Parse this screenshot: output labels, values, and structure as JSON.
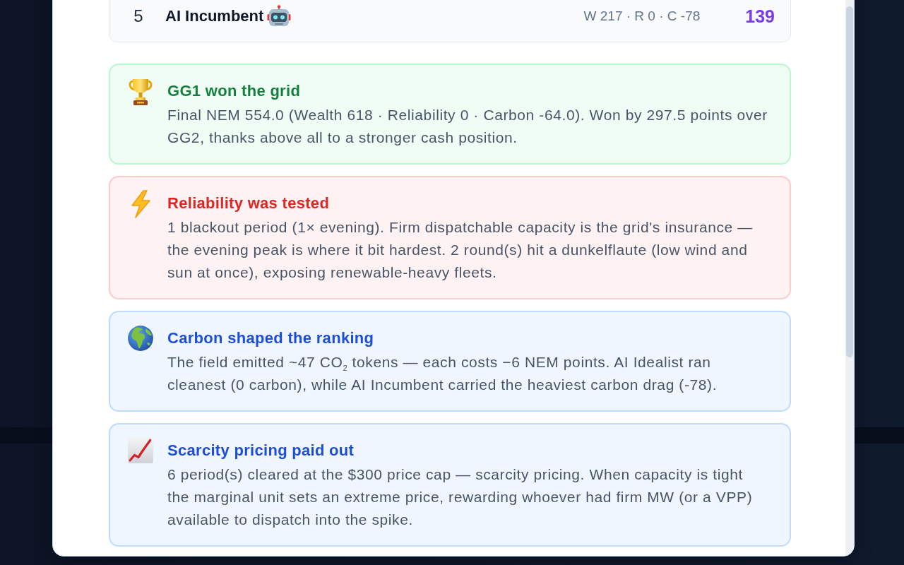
{
  "leaderboard_row": {
    "rank": "5",
    "name": "AI Incumbent",
    "stats": "W 217 · R 0 · C -78",
    "score": "139"
  },
  "insights": [
    {
      "kind": "winner",
      "title": "GG1 won the grid",
      "text": "Final NEM 554.0 (Wealth 618 · Reliability 0 · Carbon -64.0). Won by 297.5 points over GG2, thanks above all to a stronger cash position."
    },
    {
      "kind": "reliability",
      "title": "Reliability was tested",
      "text": "1 blackout period (1× evening). Firm dispatchable capacity is the grid's insurance — the evening peak is where it bit hardest. 2 round(s) hit a dunkelflaute (low wind and sun at once), exposing renewable-heavy fleets."
    },
    {
      "kind": "carbon",
      "title": "Carbon shaped the ranking",
      "text": "The field emitted ~47 CO$_{2}$ tokens — each costs −6 NEM points. AI Idealist ran cleanest (0 carbon), while AI Incumbent carried the heaviest carbon drag (-78)."
    },
    {
      "kind": "pricing",
      "title": "Scarcity pricing paid out",
      "text": "6 period(s) cleared at the $300 price cap — scarcity pricing. When capacity is tight the marginal unit sets an extreme price, rewarding whoever had firm MW (or a VPP) available to dispatch into the spike."
    }
  ]
}
